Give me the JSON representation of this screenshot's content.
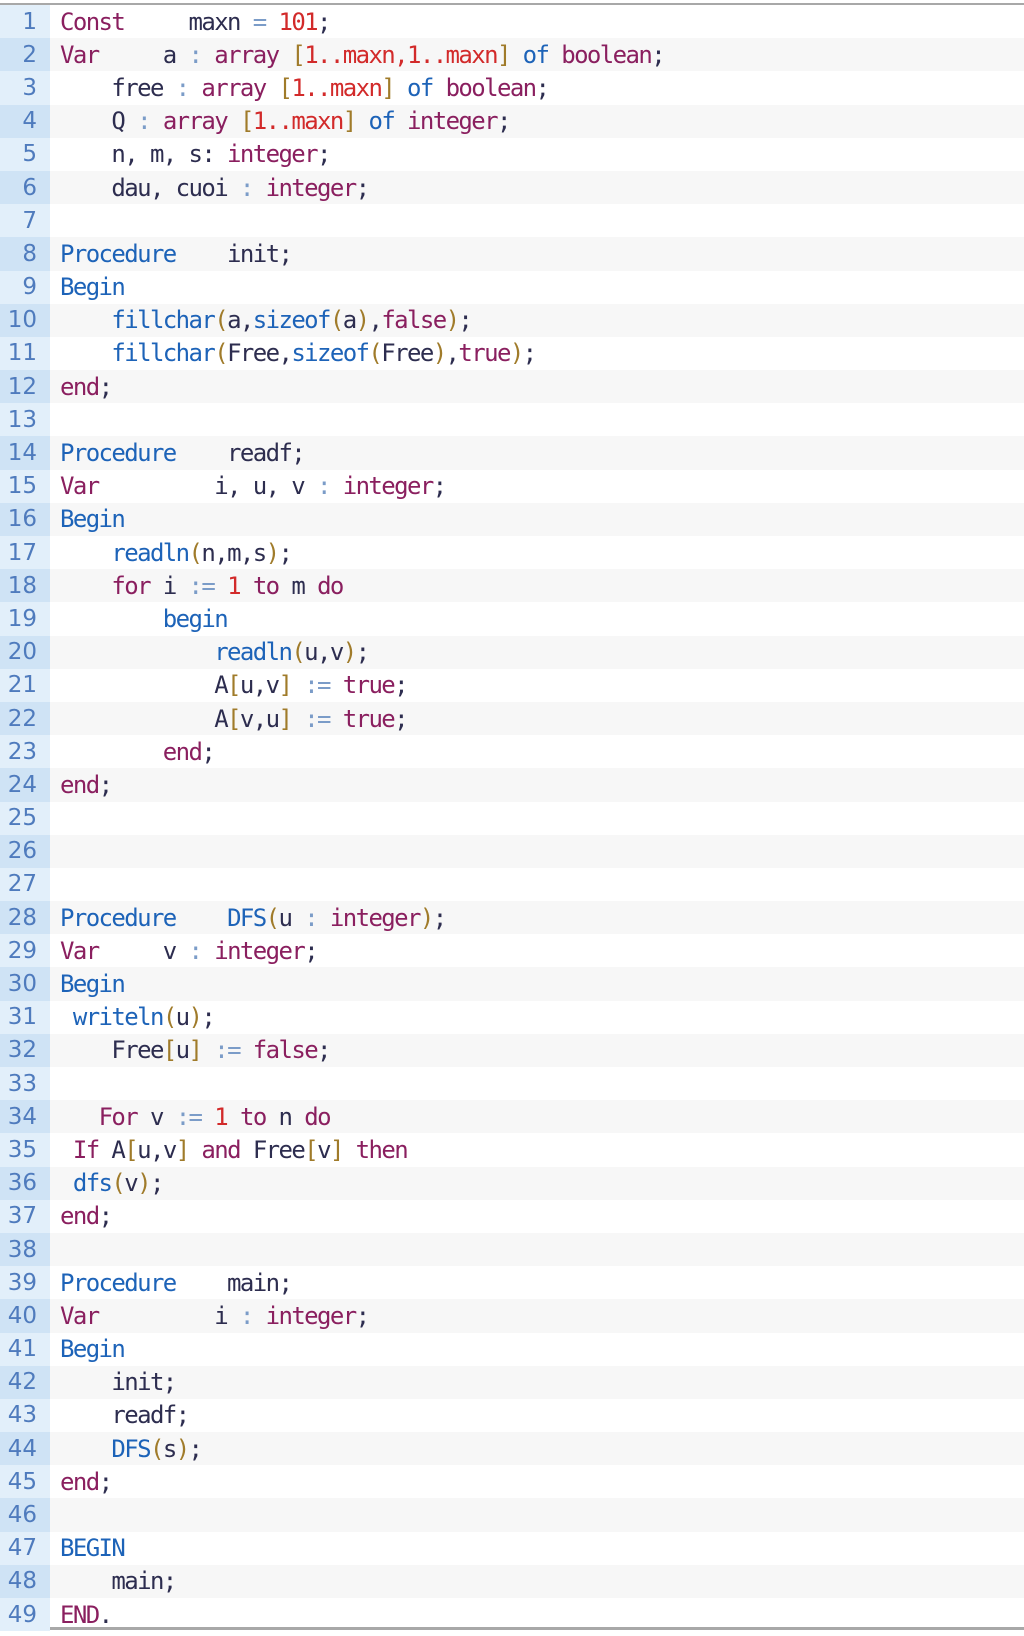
{
  "editor": {
    "language": "pascal",
    "lines": [
      {
        "n": "1",
        "tokens": [
          [
            "kw",
            "Const"
          ],
          [
            "id",
            "     maxn "
          ],
          [
            "op",
            "="
          ],
          [
            "id",
            " "
          ],
          [
            "num",
            "101"
          ],
          [
            "id",
            ";"
          ]
        ]
      },
      {
        "n": "2",
        "tokens": [
          [
            "kw",
            "Var"
          ],
          [
            "id",
            "     a "
          ],
          [
            "op",
            ":"
          ],
          [
            "id",
            " "
          ],
          [
            "kw",
            "array"
          ],
          [
            "id",
            " "
          ],
          [
            "br",
            "["
          ],
          [
            "num",
            "1..maxn,1..maxn"
          ],
          [
            "br",
            "]"
          ],
          [
            "id",
            " "
          ],
          [
            "kb",
            "of"
          ],
          [
            "id",
            " "
          ],
          [
            "kw",
            "boolean"
          ],
          [
            "id",
            ";"
          ]
        ]
      },
      {
        "n": "3",
        "tokens": [
          [
            "id",
            "    free "
          ],
          [
            "op",
            ":"
          ],
          [
            "id",
            " "
          ],
          [
            "kw",
            "array"
          ],
          [
            "id",
            " "
          ],
          [
            "br",
            "["
          ],
          [
            "num",
            "1..maxn"
          ],
          [
            "br",
            "]"
          ],
          [
            "id",
            " "
          ],
          [
            "kb",
            "of"
          ],
          [
            "id",
            " "
          ],
          [
            "kw",
            "boolean"
          ],
          [
            "id",
            ";"
          ]
        ]
      },
      {
        "n": "4",
        "tokens": [
          [
            "id",
            "    Q "
          ],
          [
            "op",
            ":"
          ],
          [
            "id",
            " "
          ],
          [
            "kw",
            "array"
          ],
          [
            "id",
            " "
          ],
          [
            "br",
            "["
          ],
          [
            "num",
            "1..maxn"
          ],
          [
            "br",
            "]"
          ],
          [
            "id",
            " "
          ],
          [
            "kb",
            "of"
          ],
          [
            "id",
            " "
          ],
          [
            "kw",
            "integer"
          ],
          [
            "id",
            ";"
          ]
        ]
      },
      {
        "n": "5",
        "tokens": [
          [
            "id",
            "    n, m, s: "
          ],
          [
            "kw",
            "integer"
          ],
          [
            "id",
            ";"
          ]
        ]
      },
      {
        "n": "6",
        "tokens": [
          [
            "id",
            "    dau, cuoi "
          ],
          [
            "op",
            ":"
          ],
          [
            "id",
            " "
          ],
          [
            "kw",
            "integer"
          ],
          [
            "id",
            ";"
          ]
        ]
      },
      {
        "n": "7",
        "tokens": []
      },
      {
        "n": "8",
        "tokens": [
          [
            "kb",
            "Procedure"
          ],
          [
            "id",
            "    init;"
          ]
        ]
      },
      {
        "n": "9",
        "tokens": [
          [
            "kb",
            "Begin"
          ]
        ]
      },
      {
        "n": "10",
        "tokens": [
          [
            "id",
            "    "
          ],
          [
            "kb",
            "fillchar"
          ],
          [
            "br",
            "("
          ],
          [
            "id",
            "a,"
          ],
          [
            "kb",
            "sizeof"
          ],
          [
            "br",
            "("
          ],
          [
            "id",
            "a"
          ],
          [
            "br",
            ")"
          ],
          [
            "id",
            ","
          ],
          [
            "kw",
            "false"
          ],
          [
            "br",
            ")"
          ],
          [
            "id",
            ";"
          ]
        ]
      },
      {
        "n": "11",
        "tokens": [
          [
            "id",
            "    "
          ],
          [
            "kb",
            "fillchar"
          ],
          [
            "br",
            "("
          ],
          [
            "id",
            "Free,"
          ],
          [
            "kb",
            "sizeof"
          ],
          [
            "br",
            "("
          ],
          [
            "id",
            "Free"
          ],
          [
            "br",
            ")"
          ],
          [
            "id",
            ","
          ],
          [
            "kw",
            "true"
          ],
          [
            "br",
            ")"
          ],
          [
            "id",
            ";"
          ]
        ]
      },
      {
        "n": "12",
        "tokens": [
          [
            "kw",
            "end"
          ],
          [
            "id",
            ";"
          ]
        ]
      },
      {
        "n": "13",
        "tokens": []
      },
      {
        "n": "14",
        "tokens": [
          [
            "kb",
            "Procedure"
          ],
          [
            "id",
            "    readf;"
          ]
        ]
      },
      {
        "n": "15",
        "tokens": [
          [
            "kw",
            "Var"
          ],
          [
            "id",
            "         i, u, v "
          ],
          [
            "op",
            ":"
          ],
          [
            "id",
            " "
          ],
          [
            "kw",
            "integer"
          ],
          [
            "id",
            ";"
          ]
        ]
      },
      {
        "n": "16",
        "tokens": [
          [
            "kb",
            "Begin"
          ]
        ]
      },
      {
        "n": "17",
        "tokens": [
          [
            "id",
            "    "
          ],
          [
            "kb",
            "readln"
          ],
          [
            "br",
            "("
          ],
          [
            "id",
            "n,m,s"
          ],
          [
            "br",
            ")"
          ],
          [
            "id",
            ";"
          ]
        ]
      },
      {
        "n": "18",
        "tokens": [
          [
            "id",
            "    "
          ],
          [
            "kw",
            "for"
          ],
          [
            "id",
            " i "
          ],
          [
            "op",
            ":="
          ],
          [
            "id",
            " "
          ],
          [
            "num",
            "1"
          ],
          [
            "id",
            " "
          ],
          [
            "kw",
            "to"
          ],
          [
            "id",
            " m "
          ],
          [
            "kw",
            "do"
          ]
        ]
      },
      {
        "n": "19",
        "tokens": [
          [
            "id",
            "        "
          ],
          [
            "kb",
            "begin"
          ]
        ]
      },
      {
        "n": "20",
        "tokens": [
          [
            "id",
            "            "
          ],
          [
            "kb",
            "readln"
          ],
          [
            "br",
            "("
          ],
          [
            "id",
            "u,v"
          ],
          [
            "br",
            ")"
          ],
          [
            "id",
            ";"
          ]
        ]
      },
      {
        "n": "21",
        "tokens": [
          [
            "id",
            "            A"
          ],
          [
            "br",
            "["
          ],
          [
            "id",
            "u,v"
          ],
          [
            "br",
            "]"
          ],
          [
            "id",
            " "
          ],
          [
            "op",
            ":="
          ],
          [
            "id",
            " "
          ],
          [
            "kw",
            "true"
          ],
          [
            "id",
            ";"
          ]
        ]
      },
      {
        "n": "22",
        "tokens": [
          [
            "id",
            "            A"
          ],
          [
            "br",
            "["
          ],
          [
            "id",
            "v,u"
          ],
          [
            "br",
            "]"
          ],
          [
            "id",
            " "
          ],
          [
            "op",
            ":="
          ],
          [
            "id",
            " "
          ],
          [
            "kw",
            "true"
          ],
          [
            "id",
            ";"
          ]
        ]
      },
      {
        "n": "23",
        "tokens": [
          [
            "id",
            "        "
          ],
          [
            "kw",
            "end"
          ],
          [
            "id",
            ";"
          ]
        ]
      },
      {
        "n": "24",
        "tokens": [
          [
            "kw",
            "end"
          ],
          [
            "id",
            ";"
          ]
        ]
      },
      {
        "n": "25",
        "tokens": []
      },
      {
        "n": "26",
        "tokens": []
      },
      {
        "n": "27",
        "tokens": []
      },
      {
        "n": "28",
        "tokens": [
          [
            "kb",
            "Procedure"
          ],
          [
            "id",
            "    "
          ],
          [
            "kb",
            "DFS"
          ],
          [
            "br",
            "("
          ],
          [
            "id",
            "u "
          ],
          [
            "op",
            ":"
          ],
          [
            "id",
            " "
          ],
          [
            "kw",
            "integer"
          ],
          [
            "br",
            ")"
          ],
          [
            "id",
            ";"
          ]
        ]
      },
      {
        "n": "29",
        "tokens": [
          [
            "kw",
            "Var"
          ],
          [
            "id",
            "     v "
          ],
          [
            "op",
            ":"
          ],
          [
            "id",
            " "
          ],
          [
            "kw",
            "integer"
          ],
          [
            "id",
            ";"
          ]
        ]
      },
      {
        "n": "30",
        "tokens": [
          [
            "kb",
            "Begin"
          ]
        ]
      },
      {
        "n": "31",
        "tokens": [
          [
            "id",
            " "
          ],
          [
            "kb",
            "writeln"
          ],
          [
            "br",
            "("
          ],
          [
            "id",
            "u"
          ],
          [
            "br",
            ")"
          ],
          [
            "id",
            ";"
          ]
        ]
      },
      {
        "n": "32",
        "tokens": [
          [
            "id",
            "    Free"
          ],
          [
            "br",
            "["
          ],
          [
            "id",
            "u"
          ],
          [
            "br",
            "]"
          ],
          [
            "id",
            " "
          ],
          [
            "op",
            ":="
          ],
          [
            "id",
            " "
          ],
          [
            "kw",
            "false"
          ],
          [
            "id",
            ";"
          ]
        ]
      },
      {
        "n": "33",
        "tokens": []
      },
      {
        "n": "34",
        "tokens": [
          [
            "id",
            "   "
          ],
          [
            "kw",
            "For"
          ],
          [
            "id",
            " v "
          ],
          [
            "op",
            ":="
          ],
          [
            "id",
            " "
          ],
          [
            "num",
            "1"
          ],
          [
            "id",
            " "
          ],
          [
            "kw",
            "to"
          ],
          [
            "id",
            " n "
          ],
          [
            "kw",
            "do"
          ]
        ]
      },
      {
        "n": "35",
        "tokens": [
          [
            "id",
            " "
          ],
          [
            "kw",
            "If"
          ],
          [
            "id",
            " A"
          ],
          [
            "br",
            "["
          ],
          [
            "id",
            "u,v"
          ],
          [
            "br",
            "]"
          ],
          [
            "id",
            " "
          ],
          [
            "kw",
            "and"
          ],
          [
            "id",
            " Free"
          ],
          [
            "br",
            "["
          ],
          [
            "id",
            "v"
          ],
          [
            "br",
            "]"
          ],
          [
            "id",
            " "
          ],
          [
            "kw",
            "then"
          ]
        ]
      },
      {
        "n": "36",
        "tokens": [
          [
            "id",
            " "
          ],
          [
            "kb",
            "dfs"
          ],
          [
            "br",
            "("
          ],
          [
            "id",
            "v"
          ],
          [
            "br",
            ")"
          ],
          [
            "id",
            ";"
          ]
        ]
      },
      {
        "n": "37",
        "tokens": [
          [
            "kw",
            "end"
          ],
          [
            "id",
            ";"
          ]
        ]
      },
      {
        "n": "38",
        "tokens": []
      },
      {
        "n": "39",
        "tokens": [
          [
            "kb",
            "Procedure"
          ],
          [
            "id",
            "    main;"
          ]
        ]
      },
      {
        "n": "40",
        "tokens": [
          [
            "kw",
            "Var"
          ],
          [
            "id",
            "         i "
          ],
          [
            "op",
            ":"
          ],
          [
            "id",
            " "
          ],
          [
            "kw",
            "integer"
          ],
          [
            "id",
            ";"
          ]
        ]
      },
      {
        "n": "41",
        "tokens": [
          [
            "kb",
            "Begin"
          ]
        ]
      },
      {
        "n": "42",
        "tokens": [
          [
            "id",
            "    init;"
          ]
        ]
      },
      {
        "n": "43",
        "tokens": [
          [
            "id",
            "    readf;"
          ]
        ]
      },
      {
        "n": "44",
        "tokens": [
          [
            "id",
            "    "
          ],
          [
            "kb",
            "DFS"
          ],
          [
            "br",
            "("
          ],
          [
            "id",
            "s"
          ],
          [
            "br",
            ")"
          ],
          [
            "id",
            ";"
          ]
        ]
      },
      {
        "n": "45",
        "tokens": [
          [
            "kw",
            "end"
          ],
          [
            "id",
            ";"
          ]
        ]
      },
      {
        "n": "46",
        "tokens": []
      },
      {
        "n": "47",
        "tokens": [
          [
            "kb",
            "BEGIN"
          ]
        ]
      },
      {
        "n": "48",
        "tokens": [
          [
            "id",
            "    main;"
          ]
        ]
      },
      {
        "n": "49",
        "tokens": [
          [
            "kw",
            "END"
          ],
          [
            "id",
            "."
          ]
        ]
      }
    ]
  }
}
